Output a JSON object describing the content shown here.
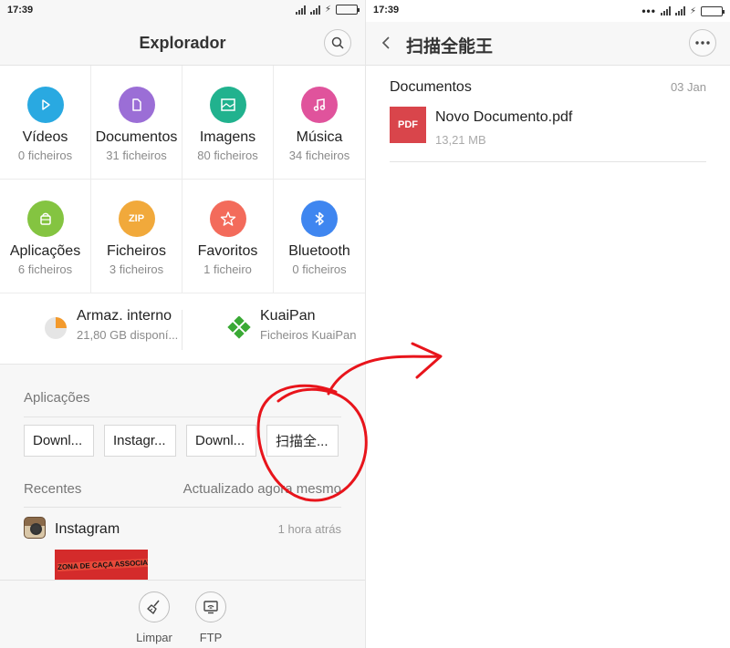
{
  "left": {
    "status": {
      "time": "17:39"
    },
    "header": {
      "title": "Explorador",
      "search_icon": "search-icon"
    },
    "categories": [
      {
        "label": "Vídeos",
        "count": "0 ficheiros",
        "icon": "play-icon",
        "color": "#29a9e1"
      },
      {
        "label": "Documentos",
        "count": "31 ficheiros",
        "icon": "document-icon",
        "color": "#9b6ed6"
      },
      {
        "label": "Imagens",
        "count": "80 ficheiros",
        "icon": "image-icon",
        "color": "#21b28e"
      },
      {
        "label": "Música",
        "count": "34 ficheiros",
        "icon": "music-icon",
        "color": "#e0539c"
      },
      {
        "label": "Aplicações",
        "count": "6 ficheiros",
        "icon": "android-icon",
        "color": "#84c441"
      },
      {
        "label": "Ficheiros",
        "count": "3 ficheiros",
        "icon": "zip-icon",
        "icon_text": "ZIP",
        "color": "#f1a93b"
      },
      {
        "label": "Favoritos",
        "count": "1 ficheiro",
        "icon": "star-icon",
        "color": "#f36b5b"
      },
      {
        "label": "Bluetooth",
        "count": "0 ficheiros",
        "icon": "bluetooth-icon",
        "color": "#3f86f0"
      }
    ],
    "storage": [
      {
        "title": "Armaz. interno",
        "subtitle": "21,80 GB disponí...",
        "icon": "storage-pie-icon"
      },
      {
        "title": "KuaiPan",
        "subtitle": "Ficheiros KuaiPan",
        "icon": "kuaipan-icon"
      }
    ],
    "apps": {
      "label": "Aplicações",
      "items": [
        "Downl...",
        "Instagr...",
        "Downl...",
        "扫描全..."
      ]
    },
    "recent": {
      "label": "Recentes",
      "updated": "Actualizado agora mesmo",
      "item_name": "Instagram",
      "item_time": "1 hora atrás",
      "thumb_text": "ZONA DE CAÇA ASSOCIATIVA"
    },
    "bottom": [
      {
        "label": "Limpar",
        "icon": "broom-icon"
      },
      {
        "label": "FTP",
        "icon": "ftp-icon"
      }
    ]
  },
  "right": {
    "status": {
      "time": "17:39"
    },
    "header": {
      "title": "扫描全能王"
    },
    "section": {
      "title": "Documentos",
      "date": "03 Jan"
    },
    "file": {
      "badge": "PDF",
      "name": "Novo Documento.pdf",
      "size": "13,21 MB"
    }
  },
  "colors": {
    "annotation": "#e8141b",
    "battery": "#4cd137"
  }
}
